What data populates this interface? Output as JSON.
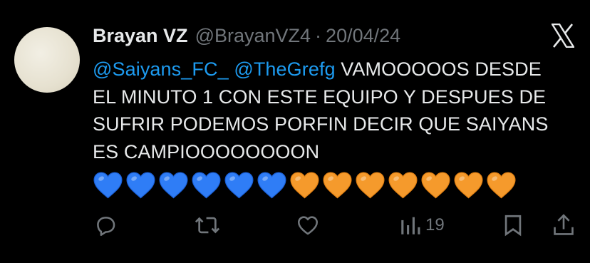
{
  "tweet": {
    "author_name": "Brayan VZ",
    "author_handle": "@BrayanVZ4",
    "separator": "·",
    "date": "20/04/24",
    "mentions": [
      "@Saiyans_FC_",
      "@TheGrefg"
    ],
    "body_text": "VAMOOOOOS DESDE EL MINUTO 1 CON ESTE EQUIPO Y DESPUES DE SUFRIR PODEMOS PORFIN DECIR QUE SAIYANS ES CAMPIOOOOOOOON",
    "emojis": [
      "blue-heart",
      "blue-heart",
      "blue-heart",
      "blue-heart",
      "blue-heart",
      "blue-heart",
      "orange-heart",
      "orange-heart",
      "orange-heart",
      "orange-heart",
      "orange-heart",
      "orange-heart",
      "orange-heart"
    ]
  },
  "actions": {
    "reply": {
      "icon": "reply-icon"
    },
    "repost": {
      "icon": "repost-icon"
    },
    "like": {
      "icon": "like-icon"
    },
    "views": {
      "icon": "views-icon",
      "count": "19"
    },
    "bookmark": {
      "icon": "bookmark-icon"
    },
    "share": {
      "icon": "share-icon"
    }
  },
  "colors": {
    "background": "#000000",
    "text": "#e7e9ea",
    "secondary": "#71767b",
    "mention": "#1d9bf0",
    "blue_heart": "#2f7df6",
    "orange_heart": "#f59a2c"
  }
}
